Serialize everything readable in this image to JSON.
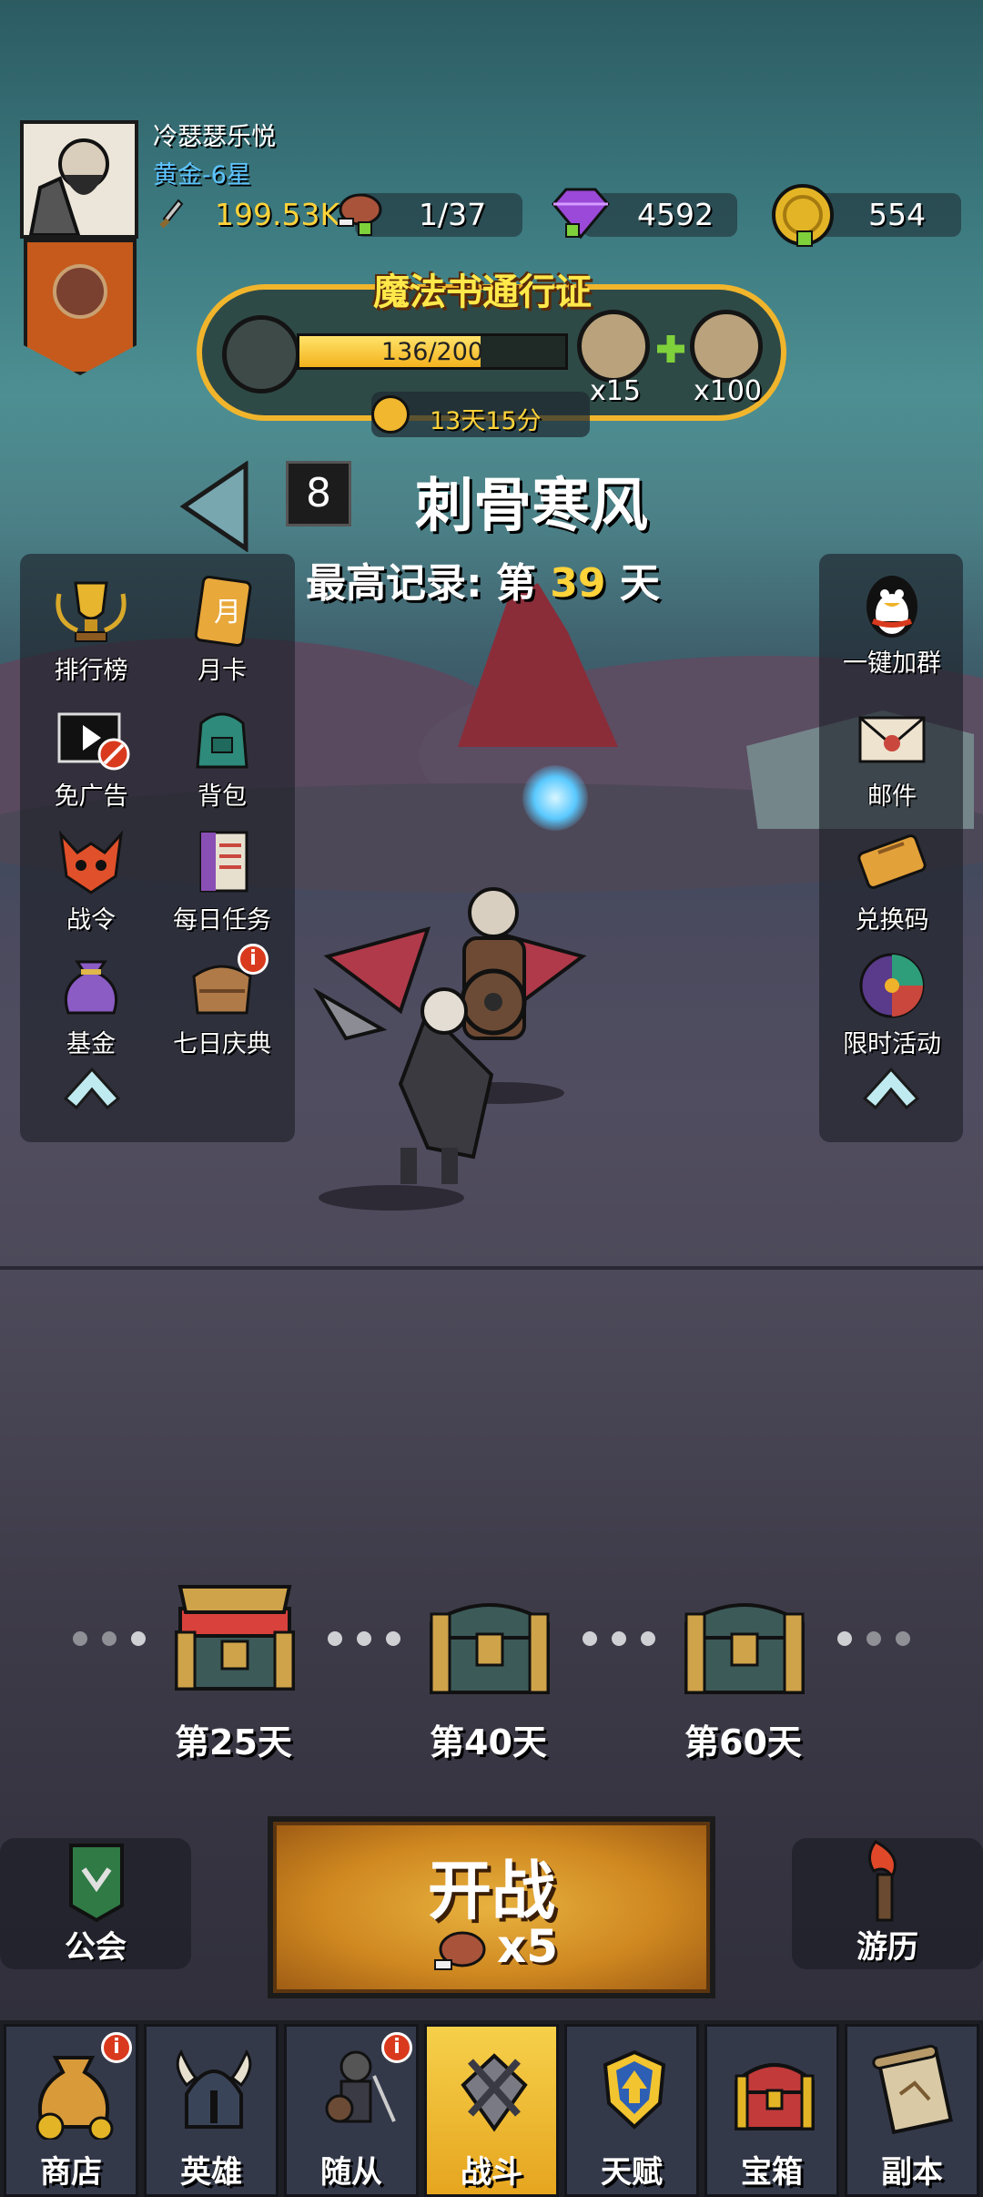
{
  "player": {
    "name": "冷瑟瑟乐悦",
    "rank": "黄金-6星",
    "power": "199.53K"
  },
  "resources": {
    "stamina": "1/37",
    "gems": "4592",
    "coins": "554"
  },
  "pass": {
    "title": "魔法书通行证",
    "progress_text": "136/200",
    "progress_fraction": 0.68,
    "reward1_count": "x15",
    "reward2_count": "x100",
    "timer": "13天15分"
  },
  "stage": {
    "number": "8",
    "name": "刺骨寒风",
    "record_prefix": "最高记录: 第",
    "record_day": "39",
    "record_suffix": "天"
  },
  "left_menu": {
    "ranking": "排行榜",
    "monthly_card": "月卡",
    "no_ads": "免广告",
    "backpack": "背包",
    "battle_pass": "战令",
    "daily_tasks": "每日任务",
    "fund": "基金",
    "seven_day": "七日庆典"
  },
  "right_menu": {
    "join_group": "一键加群",
    "mail": "邮件",
    "redeem_code": "兑换码",
    "limited_event": "限时活动"
  },
  "milestones": [
    {
      "label": "第25天"
    },
    {
      "label": "第40天"
    },
    {
      "label": "第60天"
    }
  ],
  "actions": {
    "guild": "公会",
    "fight": "开战",
    "fight_cost": "x5",
    "travel": "游历"
  },
  "badge_symbol": "i",
  "nav": {
    "shop": "商店",
    "heroes": "英雄",
    "followers": "随从",
    "battle": "战斗",
    "talent": "天赋",
    "chest": "宝箱",
    "dungeon": "副本"
  },
  "colors": {
    "accent_gold": "#ffd33a",
    "rank_blue": "#5ec4ff",
    "badge_red": "#d93a1e",
    "fight_orange": "#cf8820"
  }
}
